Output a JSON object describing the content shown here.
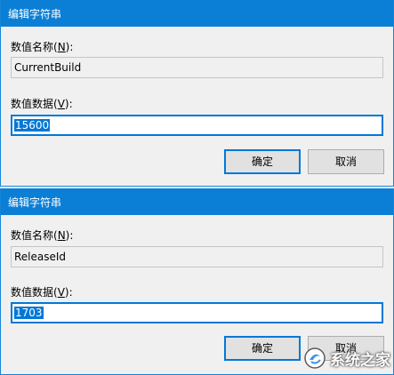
{
  "dialogs": [
    {
      "title": "编辑字符串",
      "name_label_prefix": "数值名称(",
      "name_label_key": "N",
      "name_label_suffix": "):",
      "name_value": "CurrentBuild",
      "data_label_prefix": "数值数据(",
      "data_label_key": "V",
      "data_label_suffix": "):",
      "data_value": "15600",
      "ok_label": "确定",
      "cancel_label": "取消"
    },
    {
      "title": "编辑字符串",
      "name_label_prefix": "数值名称(",
      "name_label_key": "N",
      "name_label_suffix": "):",
      "name_value": "ReleaseId",
      "data_label_prefix": "数值数据(",
      "data_label_key": "V",
      "data_label_suffix": "):",
      "data_value": "1703",
      "ok_label": "确定",
      "cancel_label": "取消"
    }
  ],
  "watermark": {
    "text": "系统之家"
  },
  "colors": {
    "titlebar": "#0b7fd6",
    "selection": "#0078d7",
    "dialog_bg": "#f0f0f0"
  }
}
